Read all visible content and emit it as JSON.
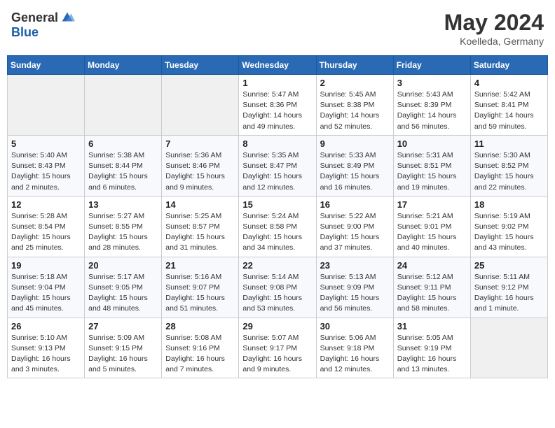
{
  "header": {
    "logo_general": "General",
    "logo_blue": "Blue",
    "title": "May 2024",
    "subtitle": "Koelleda, Germany"
  },
  "calendar": {
    "weekdays": [
      "Sunday",
      "Monday",
      "Tuesday",
      "Wednesday",
      "Thursday",
      "Friday",
      "Saturday"
    ],
    "weeks": [
      [
        {
          "day": "",
          "info": ""
        },
        {
          "day": "",
          "info": ""
        },
        {
          "day": "",
          "info": ""
        },
        {
          "day": "1",
          "info": "Sunrise: 5:47 AM\nSunset: 8:36 PM\nDaylight: 14 hours\nand 49 minutes."
        },
        {
          "day": "2",
          "info": "Sunrise: 5:45 AM\nSunset: 8:38 PM\nDaylight: 14 hours\nand 52 minutes."
        },
        {
          "day": "3",
          "info": "Sunrise: 5:43 AM\nSunset: 8:39 PM\nDaylight: 14 hours\nand 56 minutes."
        },
        {
          "day": "4",
          "info": "Sunrise: 5:42 AM\nSunset: 8:41 PM\nDaylight: 14 hours\nand 59 minutes."
        }
      ],
      [
        {
          "day": "5",
          "info": "Sunrise: 5:40 AM\nSunset: 8:43 PM\nDaylight: 15 hours\nand 2 minutes."
        },
        {
          "day": "6",
          "info": "Sunrise: 5:38 AM\nSunset: 8:44 PM\nDaylight: 15 hours\nand 6 minutes."
        },
        {
          "day": "7",
          "info": "Sunrise: 5:36 AM\nSunset: 8:46 PM\nDaylight: 15 hours\nand 9 minutes."
        },
        {
          "day": "8",
          "info": "Sunrise: 5:35 AM\nSunset: 8:47 PM\nDaylight: 15 hours\nand 12 minutes."
        },
        {
          "day": "9",
          "info": "Sunrise: 5:33 AM\nSunset: 8:49 PM\nDaylight: 15 hours\nand 16 minutes."
        },
        {
          "day": "10",
          "info": "Sunrise: 5:31 AM\nSunset: 8:51 PM\nDaylight: 15 hours\nand 19 minutes."
        },
        {
          "day": "11",
          "info": "Sunrise: 5:30 AM\nSunset: 8:52 PM\nDaylight: 15 hours\nand 22 minutes."
        }
      ],
      [
        {
          "day": "12",
          "info": "Sunrise: 5:28 AM\nSunset: 8:54 PM\nDaylight: 15 hours\nand 25 minutes."
        },
        {
          "day": "13",
          "info": "Sunrise: 5:27 AM\nSunset: 8:55 PM\nDaylight: 15 hours\nand 28 minutes."
        },
        {
          "day": "14",
          "info": "Sunrise: 5:25 AM\nSunset: 8:57 PM\nDaylight: 15 hours\nand 31 minutes."
        },
        {
          "day": "15",
          "info": "Sunrise: 5:24 AM\nSunset: 8:58 PM\nDaylight: 15 hours\nand 34 minutes."
        },
        {
          "day": "16",
          "info": "Sunrise: 5:22 AM\nSunset: 9:00 PM\nDaylight: 15 hours\nand 37 minutes."
        },
        {
          "day": "17",
          "info": "Sunrise: 5:21 AM\nSunset: 9:01 PM\nDaylight: 15 hours\nand 40 minutes."
        },
        {
          "day": "18",
          "info": "Sunrise: 5:19 AM\nSunset: 9:02 PM\nDaylight: 15 hours\nand 43 minutes."
        }
      ],
      [
        {
          "day": "19",
          "info": "Sunrise: 5:18 AM\nSunset: 9:04 PM\nDaylight: 15 hours\nand 45 minutes."
        },
        {
          "day": "20",
          "info": "Sunrise: 5:17 AM\nSunset: 9:05 PM\nDaylight: 15 hours\nand 48 minutes."
        },
        {
          "day": "21",
          "info": "Sunrise: 5:16 AM\nSunset: 9:07 PM\nDaylight: 15 hours\nand 51 minutes."
        },
        {
          "day": "22",
          "info": "Sunrise: 5:14 AM\nSunset: 9:08 PM\nDaylight: 15 hours\nand 53 minutes."
        },
        {
          "day": "23",
          "info": "Sunrise: 5:13 AM\nSunset: 9:09 PM\nDaylight: 15 hours\nand 56 minutes."
        },
        {
          "day": "24",
          "info": "Sunrise: 5:12 AM\nSunset: 9:11 PM\nDaylight: 15 hours\nand 58 minutes."
        },
        {
          "day": "25",
          "info": "Sunrise: 5:11 AM\nSunset: 9:12 PM\nDaylight: 16 hours\nand 1 minute."
        }
      ],
      [
        {
          "day": "26",
          "info": "Sunrise: 5:10 AM\nSunset: 9:13 PM\nDaylight: 16 hours\nand 3 minutes."
        },
        {
          "day": "27",
          "info": "Sunrise: 5:09 AM\nSunset: 9:15 PM\nDaylight: 16 hours\nand 5 minutes."
        },
        {
          "day": "28",
          "info": "Sunrise: 5:08 AM\nSunset: 9:16 PM\nDaylight: 16 hours\nand 7 minutes."
        },
        {
          "day": "29",
          "info": "Sunrise: 5:07 AM\nSunset: 9:17 PM\nDaylight: 16 hours\nand 9 minutes."
        },
        {
          "day": "30",
          "info": "Sunrise: 5:06 AM\nSunset: 9:18 PM\nDaylight: 16 hours\nand 12 minutes."
        },
        {
          "day": "31",
          "info": "Sunrise: 5:05 AM\nSunset: 9:19 PM\nDaylight: 16 hours\nand 13 minutes."
        },
        {
          "day": "",
          "info": ""
        }
      ]
    ]
  }
}
